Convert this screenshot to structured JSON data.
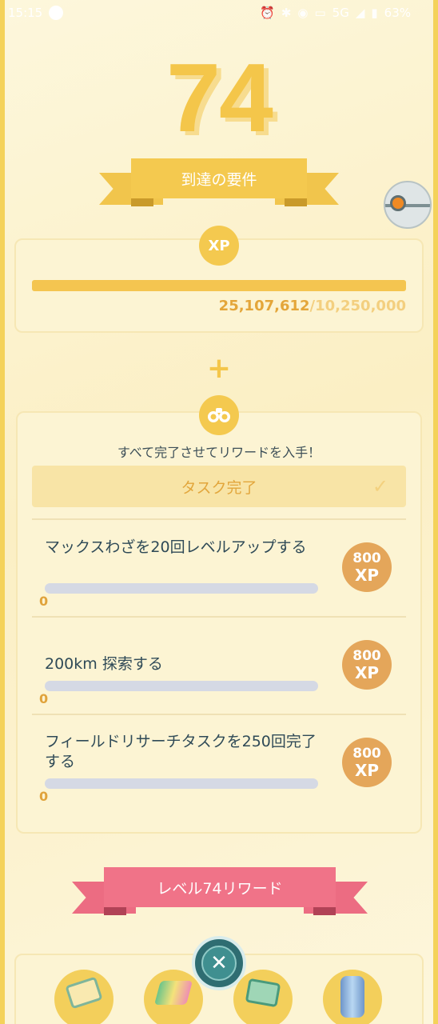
{
  "status_bar": {
    "time": "15:15",
    "network": "5G",
    "battery": "63%"
  },
  "level": {
    "number": "74"
  },
  "requirements_banner": {
    "label": "到達の要件"
  },
  "xp": {
    "badge": "XP",
    "current": "25,107,612",
    "separator": "/",
    "target": "10,250,000",
    "progress_fraction": 1.0
  },
  "connector": {
    "plus": "+"
  },
  "tasks": {
    "subtitle": "すべて完了させてリワードを入手！",
    "complete_label": "タスク完了",
    "items": [
      {
        "title": "マックスわざを20回レベルアップする",
        "progress": "0",
        "reward_amount": "800",
        "reward_unit": "XP",
        "progress_fraction": 0
      },
      {
        "title": "200km 探索する",
        "progress": "0",
        "reward_amount": "800",
        "reward_unit": "XP",
        "progress_fraction": 0
      },
      {
        "title": "フィールドリサーチタスクを250回完了する",
        "progress": "0",
        "reward_amount": "800",
        "reward_unit": "XP",
        "progress_fraction": 0
      }
    ]
  },
  "rewards_banner": {
    "label": "レベル74リワード"
  },
  "icons": {
    "binoculars": "binoculars-icon",
    "check": "check-icon",
    "close": "close-icon"
  },
  "colors": {
    "gold": "#f4c94f",
    "pink": "#f07388",
    "reward_orange": "#e4a65a",
    "teal": "#3f8f90"
  }
}
